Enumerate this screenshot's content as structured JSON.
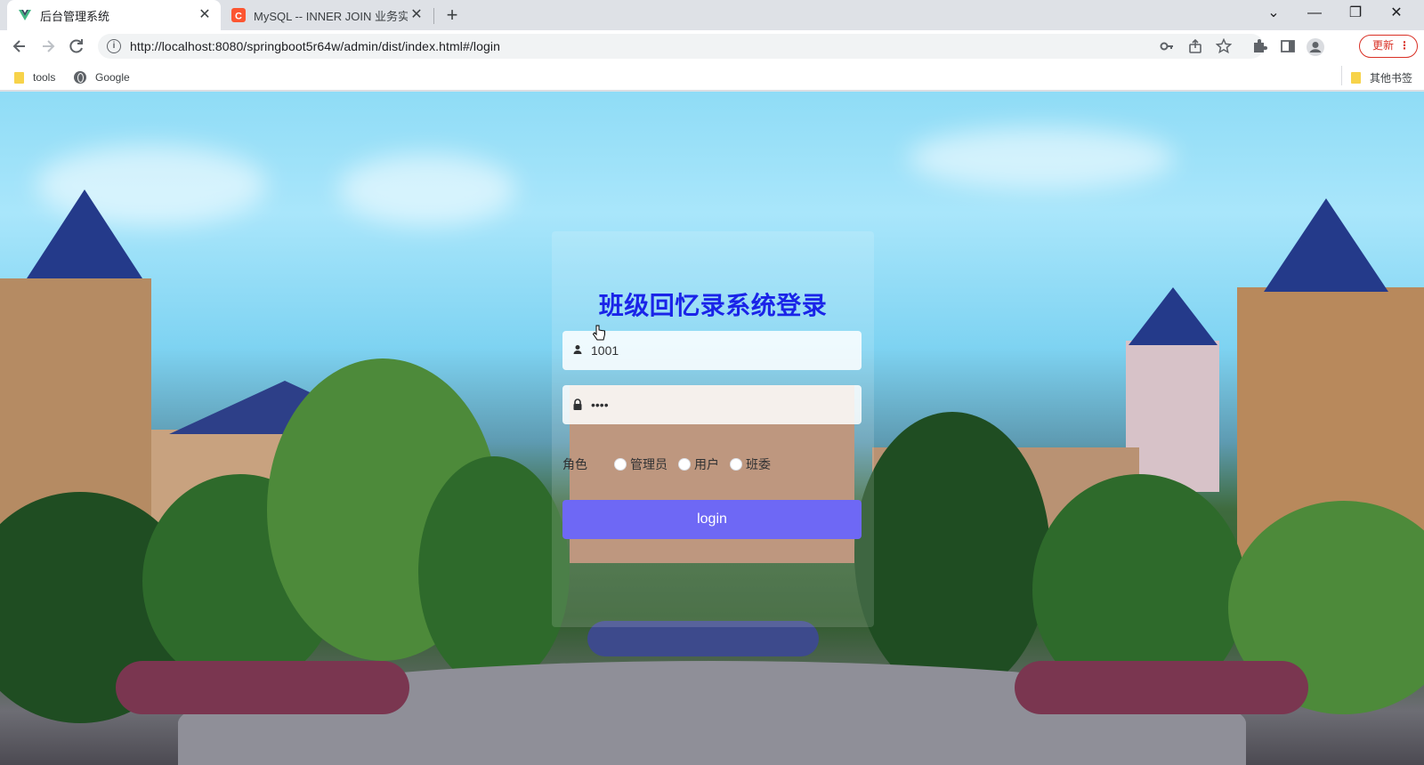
{
  "browser": {
    "tabs": [
      {
        "title": "后台管理系统",
        "active": true,
        "favicon": "vue-icon"
      },
      {
        "title": "MySQL -- INNER JOIN 业务实",
        "active": false,
        "favicon": "csdn-icon"
      }
    ],
    "new_tab_symbol": "+",
    "window_controls": {
      "minimize": "—",
      "maximize": "❐",
      "close": "✕",
      "tab_search": "⌄"
    },
    "url": "http://localhost:8080/springboot5r64w/admin/dist/index.html#/login",
    "update_button_label": "更新",
    "bookmarks": [
      {
        "label": "tools",
        "icon": "folder-icon"
      },
      {
        "label": "Google",
        "icon": "globe-icon"
      }
    ],
    "other_bookmarks_label": "其他书签"
  },
  "login": {
    "title": "班级回忆录系统登录",
    "username_value": "1001",
    "password_value": "••••",
    "role_label": "角色",
    "roles": [
      "管理员",
      "用户",
      "班委"
    ],
    "button_label": "login"
  },
  "colors": {
    "title": "#1a24e8",
    "button": "#6e68f5",
    "update_accent": "#d93025"
  }
}
